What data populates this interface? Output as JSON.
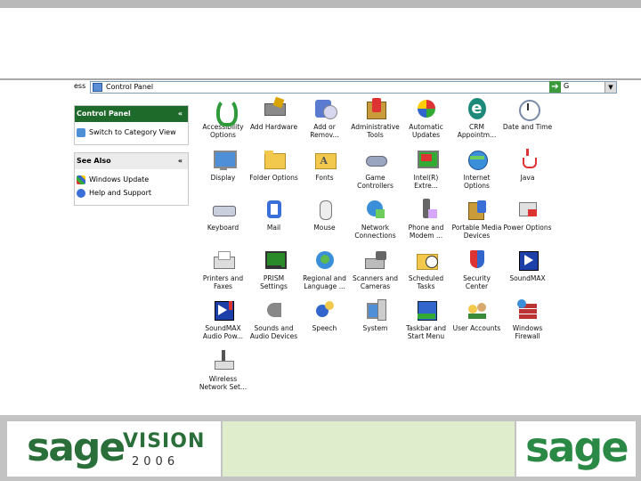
{
  "address": {
    "label": "ess",
    "path": "Control Panel",
    "go": "G"
  },
  "task_pane": {
    "control_panel": {
      "title": "Control Panel",
      "link": "Switch to Category View"
    },
    "see_also": {
      "title": "See Also",
      "links": [
        "Windows Update",
        "Help and Support"
      ]
    }
  },
  "icons": [
    {
      "l1": "Accessibility",
      "l2": "Options",
      "kind": "accessibility"
    },
    {
      "l1": "Add Hardware",
      "l2": "",
      "kind": "hardware"
    },
    {
      "l1": "Add or",
      "l2": "Remov...",
      "kind": "addremove"
    },
    {
      "l1": "Administrative",
      "l2": "Tools",
      "kind": "admin"
    },
    {
      "l1": "Automatic",
      "l2": "Updates",
      "kind": "updates"
    },
    {
      "l1": "CRM",
      "l2": "Appointm...",
      "kind": "crm"
    },
    {
      "l1": "Date and Time",
      "l2": "",
      "kind": "clock"
    },
    {
      "l1": "Display",
      "l2": "",
      "kind": "display"
    },
    {
      "l1": "Folder Options",
      "l2": "",
      "kind": "folder"
    },
    {
      "l1": "Fonts",
      "l2": "",
      "kind": "fonts"
    },
    {
      "l1": "Game",
      "l2": "Controllers",
      "kind": "game"
    },
    {
      "l1": "Intel(R)",
      "l2": "Extre...",
      "kind": "intel"
    },
    {
      "l1": "Internet",
      "l2": "Options",
      "kind": "internet"
    },
    {
      "l1": "Java",
      "l2": "",
      "kind": "java"
    },
    {
      "l1": "Keyboard",
      "l2": "",
      "kind": "keyboard"
    },
    {
      "l1": "Mail",
      "l2": "",
      "kind": "mail"
    },
    {
      "l1": "Mouse",
      "l2": "",
      "kind": "mouse"
    },
    {
      "l1": "Network",
      "l2": "Connections",
      "kind": "network"
    },
    {
      "l1": "Phone and",
      "l2": "Modem ...",
      "kind": "phone"
    },
    {
      "l1": "Portable Media",
      "l2": "Devices",
      "kind": "media"
    },
    {
      "l1": "Power Options",
      "l2": "",
      "kind": "power"
    },
    {
      "l1": "Printers and",
      "l2": "Faxes",
      "kind": "printer"
    },
    {
      "l1": "PRISM",
      "l2": "Settings",
      "kind": "prism"
    },
    {
      "l1": "Regional and",
      "l2": "Language ...",
      "kind": "globe"
    },
    {
      "l1": "Scanners and",
      "l2": "Cameras",
      "kind": "scanner"
    },
    {
      "l1": "Scheduled",
      "l2": "Tasks",
      "kind": "sched"
    },
    {
      "l1": "Security",
      "l2": "Center",
      "kind": "security"
    },
    {
      "l1": "SoundMAX",
      "l2": "",
      "kind": "soundmax"
    },
    {
      "l1": "SoundMAX",
      "l2": "Audio Pow...",
      "kind": "soundmax2"
    },
    {
      "l1": "Sounds and",
      "l2": "Audio Devices",
      "kind": "sounds"
    },
    {
      "l1": "Speech",
      "l2": "",
      "kind": "speech"
    },
    {
      "l1": "System",
      "l2": "",
      "kind": "system"
    },
    {
      "l1": "Taskbar and",
      "l2": "Start Menu",
      "kind": "taskbar"
    },
    {
      "l1": "User Accounts",
      "l2": "",
      "kind": "users"
    },
    {
      "l1": "Windows",
      "l2": "Firewall",
      "kind": "firewall"
    },
    {
      "l1": "Wireless",
      "l2": "Network Set...",
      "kind": "wireless"
    }
  ],
  "footer": {
    "logo1": "sage",
    "logo2": "VISION",
    "year": "2006",
    "logo3": "sage"
  },
  "colors": {
    "brand_green": "#2a6e3a",
    "pane_header": "#1d6a2a"
  }
}
